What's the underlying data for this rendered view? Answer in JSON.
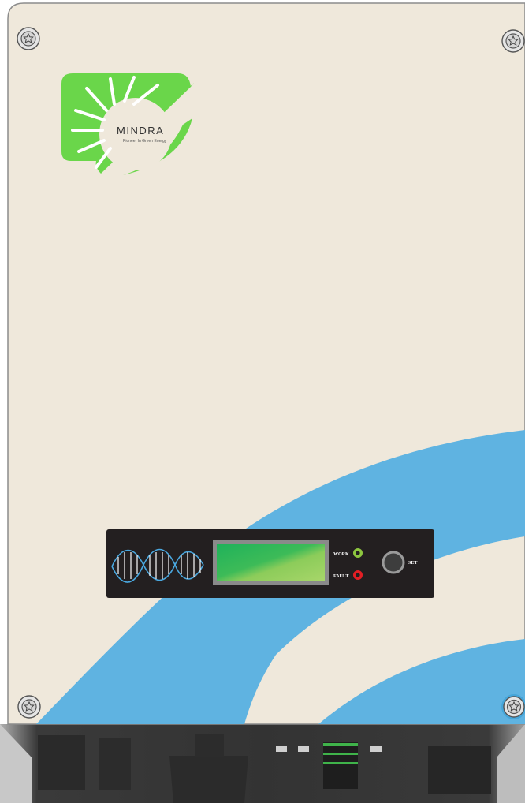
{
  "logo": {
    "brand": "MINDRA",
    "tagline": "Pioneer In Green Energy"
  },
  "panel": {
    "work_label": "WORK",
    "fault_label": "FAULT",
    "set_label": "SET",
    "work_led_color": "#8dc63f",
    "fault_led_color": "#e31e24"
  },
  "colors": {
    "body": "#efe8db",
    "wave": "#5fb3e1",
    "logo_green": "#6ad64a",
    "panel_bg": "#231f20"
  }
}
